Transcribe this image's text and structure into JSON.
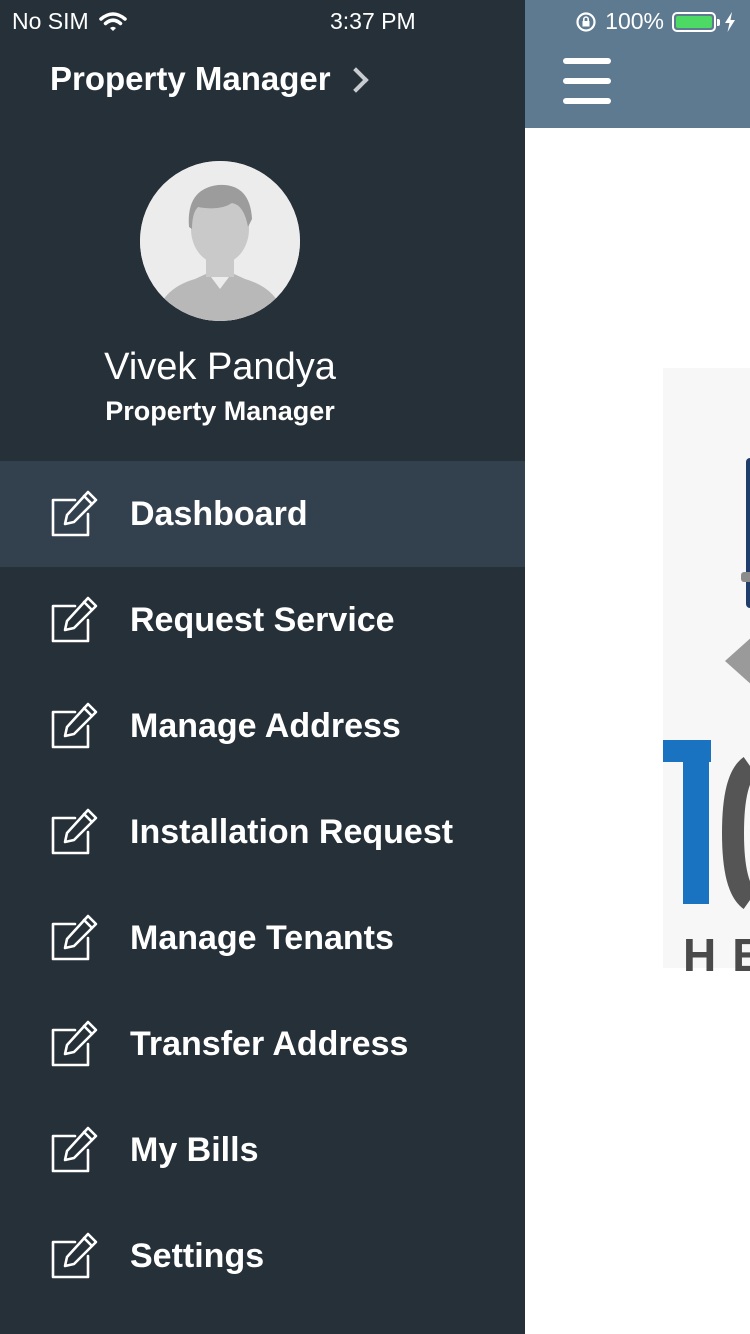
{
  "status_bar": {
    "carrier": "No SIM",
    "time": "3:37 PM",
    "battery": "100%",
    "wifi_icon": "wifi-icon",
    "lock_icon": "rotation-lock-icon",
    "charging_icon": "bolt-icon"
  },
  "drawer": {
    "header_title": "Property Manager",
    "user": {
      "name": "Vivek Pandya",
      "role": "Property Manager"
    },
    "menu": [
      {
        "label": "Dashboard",
        "icon": "edit-icon",
        "active": true
      },
      {
        "label": "Request Service",
        "icon": "edit-icon"
      },
      {
        "label": "Manage Address",
        "icon": "edit-icon"
      },
      {
        "label": "Installation Request",
        "icon": "edit-icon"
      },
      {
        "label": "Manage Tenants",
        "icon": "edit-icon"
      },
      {
        "label": "Transfer Address",
        "icon": "edit-icon"
      },
      {
        "label": "My Bills",
        "icon": "edit-icon"
      },
      {
        "label": "Settings",
        "icon": "edit-icon"
      }
    ]
  },
  "content": {
    "menu_icon": "hamburger-icon",
    "logo_partial_text": "HEA"
  },
  "colors": {
    "drawer_bg": "#263038",
    "active_item_bg": "#33414f",
    "topbar_bg": "#5e7a90",
    "battery_green": "#4cd964",
    "logo_blue": "#1a73c0"
  }
}
